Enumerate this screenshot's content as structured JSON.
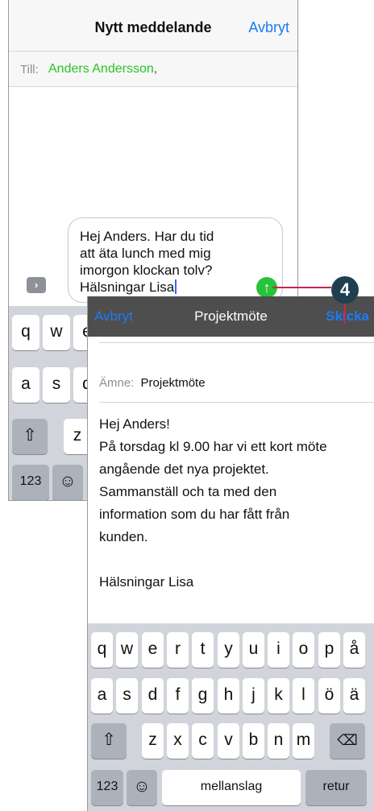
{
  "messages": {
    "title": "Nytt meddelande",
    "cancel": "Avbryt",
    "to_label": "Till:",
    "recipient": "Anders Andersson",
    "recipient_separator": ",",
    "message_lines": [
      "Hej Anders. Har du tid",
      "att äta lunch med mig",
      "imorgon klockan tolv?",
      "Hälsningar Lisa"
    ],
    "expand_icon": "chevron-right-icon",
    "send_icon": "arrow-up-icon",
    "keyboard": {
      "row1": [
        "q",
        "w",
        "e"
      ],
      "row2": [
        "a",
        "s",
        "d"
      ],
      "row3": [
        "z"
      ],
      "shift_icon": "shift-icon",
      "numbers": "123",
      "emoji_icon": "emoji-icon"
    }
  },
  "mail": {
    "cancel": "Avbryt",
    "title": "Projektmöte",
    "send": "Skicka",
    "subject_label": "Ämne:",
    "subject": "Projektmöte",
    "body_lines": [
      "Hej Anders!",
      "På torsdag kl 9.00 har vi ett kort möte",
      "angående det nya projektet.",
      "Sammanställ och ta med den",
      "information som du har fått från",
      "kunden.",
      "",
      "Hälsningar Lisa"
    ],
    "keyboard": {
      "row1": [
        "q",
        "w",
        "e",
        "r",
        "t",
        "y",
        "u",
        "i",
        "o",
        "p",
        "å"
      ],
      "row2": [
        "a",
        "s",
        "d",
        "f",
        "g",
        "h",
        "j",
        "k",
        "l",
        "ö",
        "ä"
      ],
      "row3": [
        "z",
        "x",
        "c",
        "v",
        "b",
        "n",
        "m"
      ],
      "shift_icon": "shift-icon",
      "delete_icon": "delete-icon",
      "numbers": "123",
      "emoji_icon": "emoji-icon",
      "space": "mellanslag",
      "return": "retur"
    }
  },
  "callout": {
    "number": "4",
    "color": "#1f3f50",
    "line_color": "#c8254e"
  },
  "colors": {
    "accent": "#1a7cf5",
    "recipient": "#2bc12b",
    "send_button": "#27c33a",
    "mail_nav": "#4e4e4e"
  }
}
